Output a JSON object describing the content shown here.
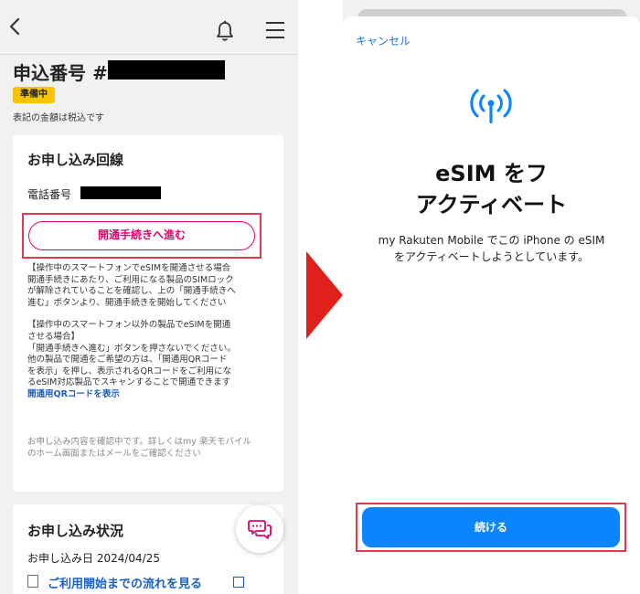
{
  "left": {
    "order_title": "申込番号 #",
    "status_badge": "準備中",
    "tax_note": "表記の金額は税込です",
    "line_card": {
      "title": "お申し込み回線",
      "phone_label": "電話番号",
      "open_button": "開通手続きへ進む",
      "notes": [
        "【操作中のスマートフォンでeSIMを開通させる場合",
        "開通手続きにあたり、ご利用になる製品のSIMロック",
        "が解除されていることを確認し、上の「開通手続きへ",
        "進む」ボタンより、開通手続きを開始してください",
        "",
        "【操作中のスマートフォン以外の製品でeSIMを開通",
        "させる場合】",
        "「開通手続きへ進む」ボタンを押さないでください。",
        "他の製品で開通をご希望の方は、「開通用QRコード",
        "を表示」を押し、表示されるQRコードをご利用にな",
        "るeSIM対応製品でスキャンすることで開通できます"
      ],
      "qr_link": "開通用QRコードを表示",
      "confirm_notes": [
        "お申し込み内容を確認中です。詳しくはmy 楽天モバイル",
        "のホーム画面またはメールをご確認ください"
      ]
    },
    "status_card": {
      "title": "お申し込み状況",
      "date": "お申し込み日 2024/04/25",
      "flow_link": "ご利用開始までの流れを見る"
    }
  },
  "right": {
    "cancel": "キャンセル",
    "title_line1": "eSIM をフ",
    "title_line2": "アクティベート",
    "desc_line1": "my Rakuten Mobile でこの iPhone の eSIM",
    "desc_line2": "をアクティベートしようとしています。",
    "continue_button": "続ける"
  },
  "colors": {
    "highlight": "#e53950",
    "pink": "#e5006e",
    "badge": "#f7c400",
    "link": "#1a5fc4",
    "ios_blue": "#0a84ff",
    "arrow": "#e0201b"
  },
  "icons": [
    "back-chevron-icon",
    "bell-icon",
    "hamburger-menu-icon",
    "chat-bubbles-icon",
    "document-icon",
    "external-link-icon",
    "antenna-signal-icon",
    "right-arrow-icon"
  ]
}
